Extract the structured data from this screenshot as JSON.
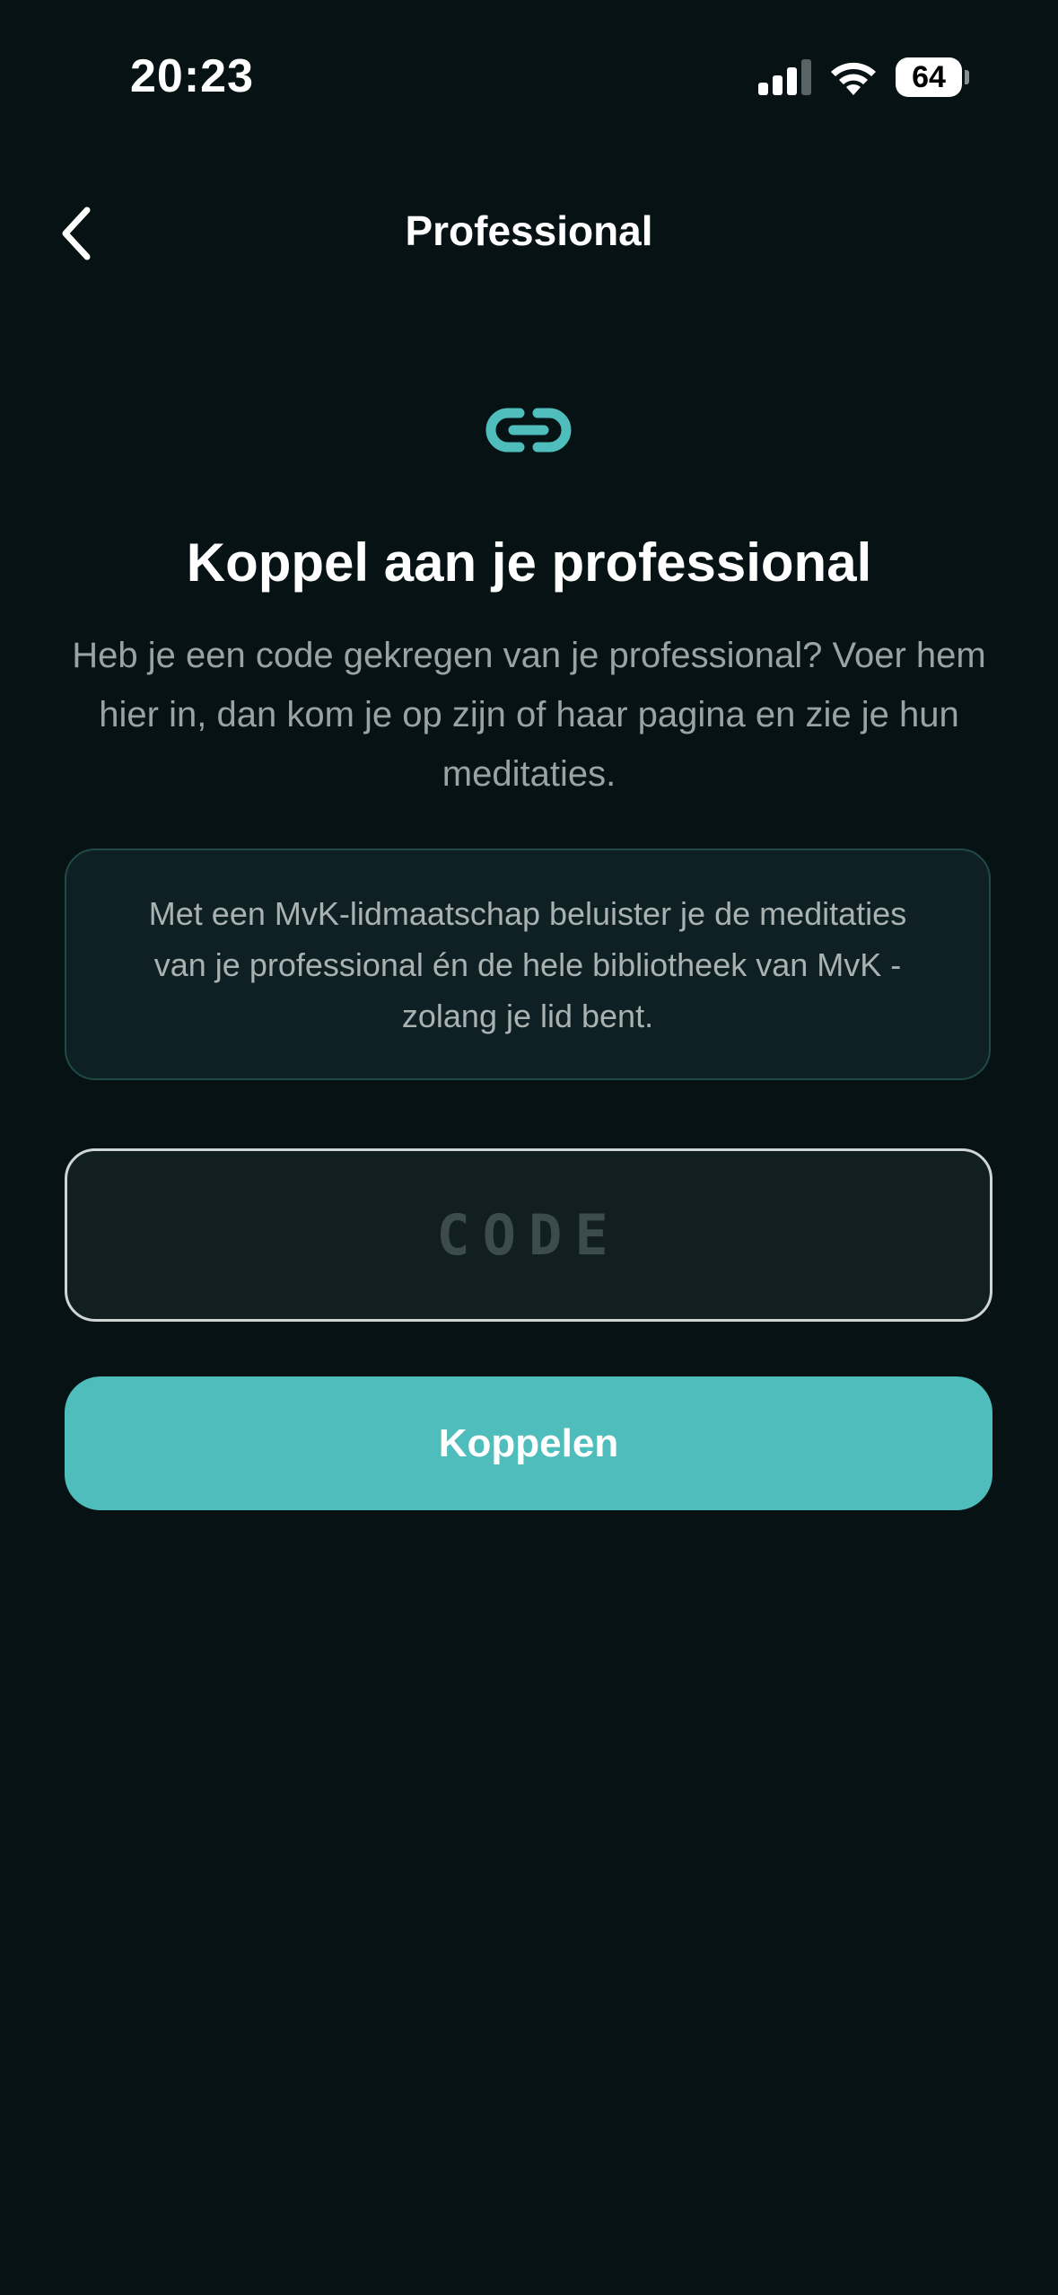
{
  "status_bar": {
    "time": "20:23",
    "battery_level": "64",
    "signal_icon": "cellular-signal-icon",
    "wifi_icon": "wifi-icon",
    "battery_icon": "battery-icon"
  },
  "nav": {
    "title": "Professional",
    "back_icon": "chevron-left-icon"
  },
  "main": {
    "icon": "link-icon",
    "heading": "Koppel aan je professional",
    "intro": "Heb je een code gekregen van je professional? Voer hem hier in, dan kom je op zijn of haar pagina en zie je hun meditaties.",
    "info_card": "Met een MvK-lidmaatschap beluister je de meditaties van je professional én de hele bibliotheek van MvK - zolang je lid bent.",
    "code_field": {
      "value": "",
      "placeholder": "CODE"
    },
    "submit_label": "Koppelen"
  },
  "colors": {
    "background": "#061213",
    "accent": "#4fbdbb",
    "card_bg": "#0e2024",
    "card_border": "#1f4a46",
    "muted_text": "#9aa3a3"
  }
}
